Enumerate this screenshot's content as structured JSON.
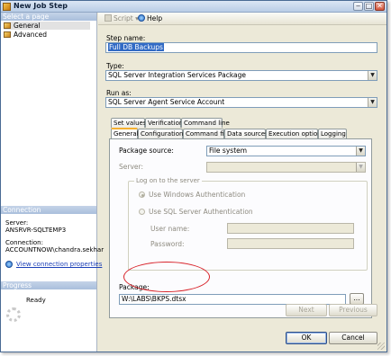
{
  "window": {
    "title": "New Job Step",
    "min": "‒",
    "max": "□",
    "close": "✕"
  },
  "left": {
    "select_page_header": "Select a page",
    "pages": [
      {
        "label": "General",
        "selected": true
      },
      {
        "label": "Advanced",
        "selected": false
      }
    ],
    "connection_header": "Connection",
    "server_label": "Server:",
    "server_value": "ANSRVR-SQLTEMP3",
    "connection_label": "Connection:",
    "connection_value": "ACCOUNTNOW\\chandra.sekhar",
    "view_connection_link": "View connection properties",
    "progress_header": "Progress",
    "progress_status": "Ready"
  },
  "toolbar": {
    "script_label": "Script",
    "help_label": "Help"
  },
  "form": {
    "step_name_label": "Step name:",
    "step_name_value": "Full DB Backups",
    "type_label": "Type:",
    "type_value": "SQL Server Integration Services Package",
    "run_as_label": "Run as:",
    "run_as_value": "SQL Server Agent Service Account"
  },
  "tabs": {
    "row1": [
      "Set values",
      "Verification",
      "Command line"
    ],
    "row2": [
      "General",
      "Configurations",
      "Command files",
      "Data sources",
      "Execution options",
      "Logging"
    ],
    "active": "General"
  },
  "general": {
    "package_source_label": "Package source:",
    "package_source_value": "File system",
    "server_label": "Server:",
    "server_value": "",
    "logon_group_title": "Log on to the server",
    "windows_auth_label": "Use Windows Authentication",
    "sql_auth_label": "Use SQL Server Authentication",
    "user_name_label": "User name:",
    "password_label": "Password:",
    "package_label": "Package:",
    "package_value": "W:\\LABS\\BKPS.dtsx",
    "browse_label": "..."
  },
  "buttons": {
    "next": "Next",
    "previous": "Previous",
    "ok": "OK",
    "cancel": "Cancel"
  }
}
